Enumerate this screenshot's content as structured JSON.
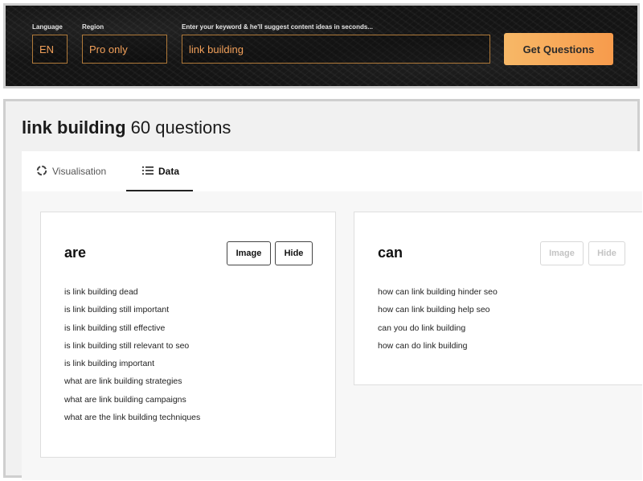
{
  "search": {
    "language_label": "Language",
    "language_value": "EN",
    "region_label": "Region",
    "region_value": "Pro only",
    "keyword_label": "Enter your keyword & he'll suggest content ideas in seconds...",
    "keyword_value": "link building",
    "submit_label": "Get Questions"
  },
  "results": {
    "keyword": "link building",
    "count_text": "60 questions"
  },
  "tabs": [
    {
      "label": "Visualisation",
      "icon": "circle-dots-icon",
      "active": false
    },
    {
      "label": "Data",
      "icon": "list-icon",
      "active": true
    }
  ],
  "cards": [
    {
      "title": "are",
      "image_label": "Image",
      "hide_label": "Hide",
      "questions": [
        "is link building dead",
        "is link building still important",
        "is link building still effective",
        "is link building still relevant to seo",
        "is link building important",
        "what are link building strategies",
        "what are link building campaigns",
        "what are the link building techniques"
      ]
    },
    {
      "title": "can",
      "image_label": "Image",
      "hide_label": "Hide",
      "questions": [
        "how can link building hinder seo",
        "how can link building help seo",
        "can you do link building",
        "how can do link building"
      ]
    }
  ],
  "colors": {
    "accent": "#f7a85a",
    "field_border": "#b07a3a"
  }
}
